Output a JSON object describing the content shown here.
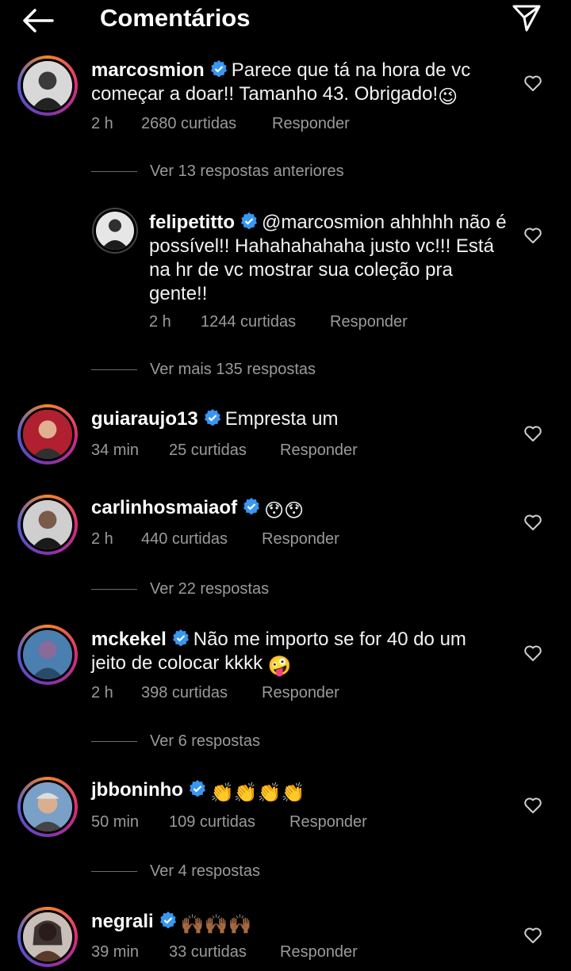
{
  "header": {
    "title": "Comentários",
    "back_icon": "arrow-left-icon",
    "send_icon": "paper-plane-icon"
  },
  "comments": [
    {
      "username": "marcosmion",
      "text": "Parece que tá na hora de vc começar a doar!! Tamanho 43. Obrigado!",
      "emoji": "😉",
      "time": "2 h",
      "likes": "2680 curtidas",
      "reply": "Responder"
    },
    {
      "view_replies": "Ver 13 respostas anteriores"
    },
    {
      "username": "felipetitto",
      "text": "@marcosmion ahhhhh não é possível!! Hahahahahaha justo vc!!! Está na hr de vc mostrar sua coleção pra gente!!",
      "time": "2 h",
      "likes": "1244 curtidas",
      "reply": "Responder"
    },
    {
      "view_replies": "Ver mais 135 respostas"
    },
    {
      "username": "guiaraujo13",
      "text": "Empresta um",
      "time": "34 min",
      "likes": "25 curtidas",
      "reply": "Responder"
    },
    {
      "username": "carlinhosmaiaof",
      "text": "",
      "emoji": "😯😯",
      "time": "2 h",
      "likes": "440 curtidas",
      "reply": "Responder"
    },
    {
      "view_replies": "Ver 22 respostas"
    },
    {
      "username": "mckekel",
      "text": "Não me importo se for 40 do um jeito de colocar kkkk",
      "emoji": "🤪",
      "time": "2 h",
      "likes": "398 curtidas",
      "reply": "Responder"
    },
    {
      "view_replies": "Ver 6 respostas"
    },
    {
      "username": "jbboninho",
      "text": "",
      "emoji": "👏👏👏👏",
      "time": "50 min",
      "likes": "109 curtidas",
      "reply": "Responder"
    },
    {
      "view_replies": "Ver 4 respostas"
    },
    {
      "username": "negrali",
      "text": "",
      "emoji": "🙌🏾🙌🏾🙌🏾",
      "time": "39 min",
      "likes": "33 curtidas",
      "reply": "Responder"
    }
  ],
  "colors": {
    "background": "#000000",
    "meta": "#9a9a9a",
    "verified": "#3897f0"
  }
}
